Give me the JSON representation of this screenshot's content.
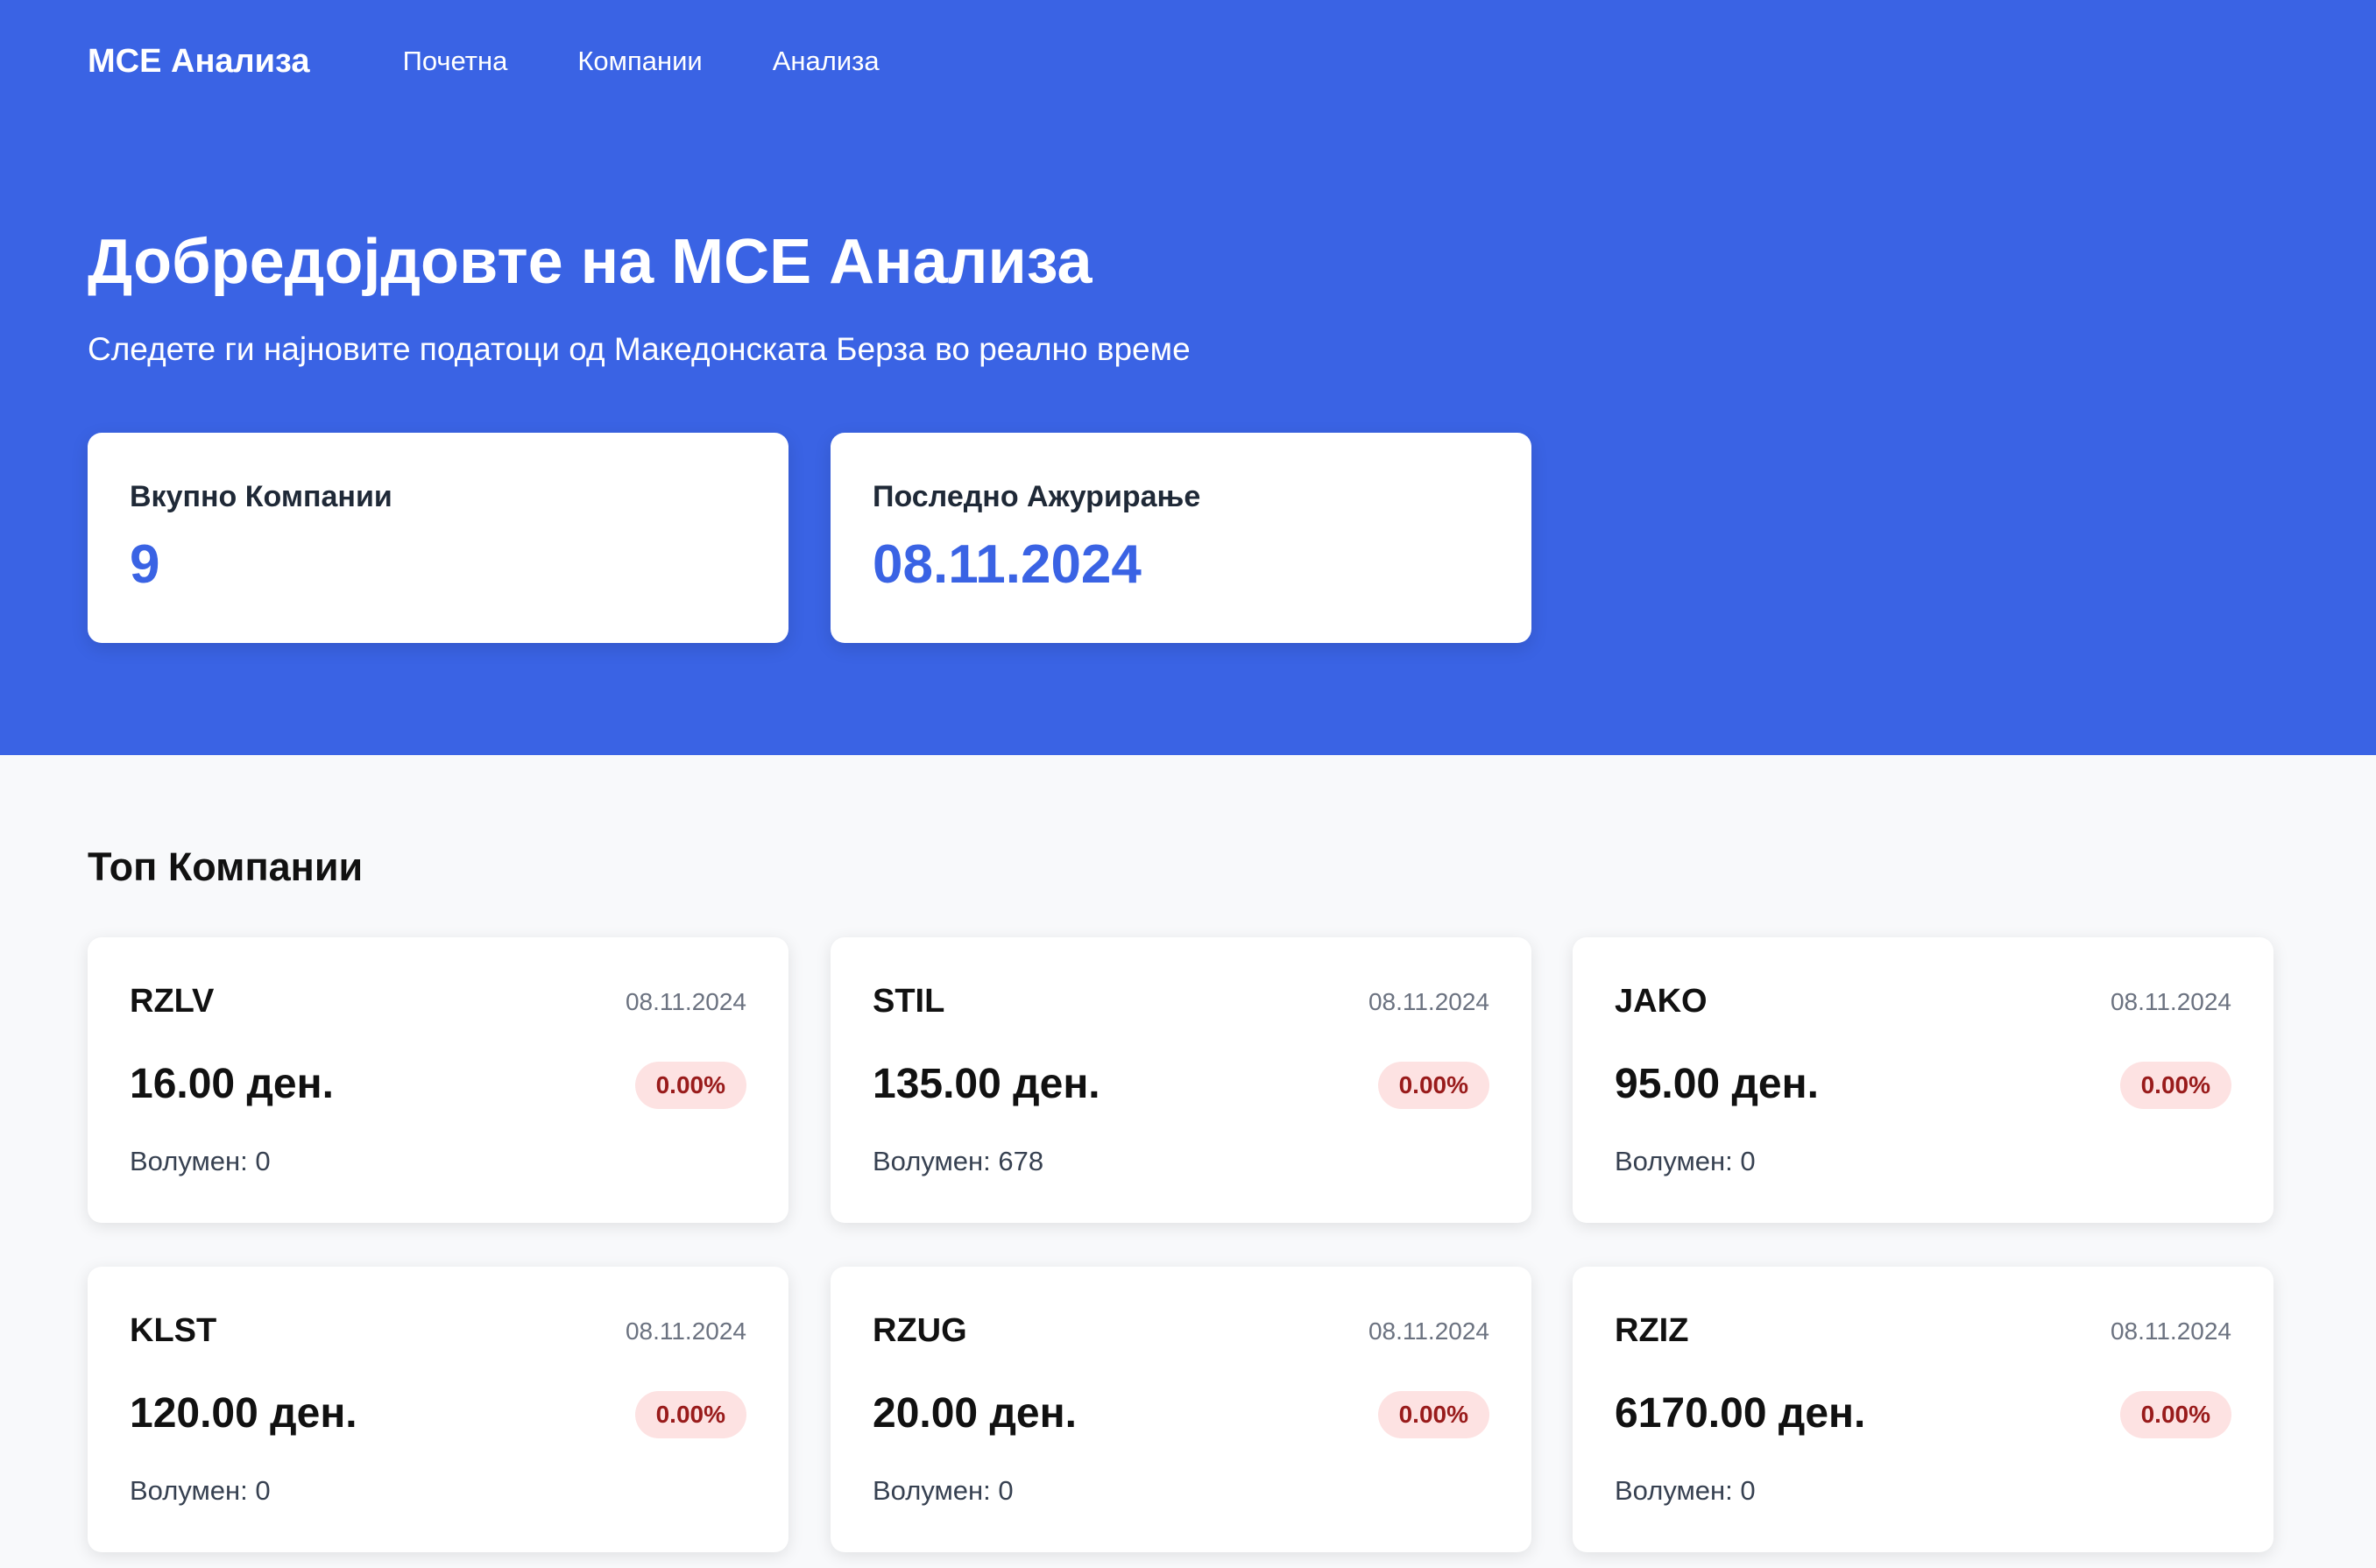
{
  "nav": {
    "brand": "МСЕ Анализа",
    "links": [
      "Почетна",
      "Компании",
      "Анализа"
    ]
  },
  "hero": {
    "title": "Добредојдовте на МСЕ Анализа",
    "subtitle": "Следете ги најновите податоци од Македонската Берза во реално време"
  },
  "stats": [
    {
      "label": "Вкупно Компании",
      "value": "9"
    },
    {
      "label": "Последно Ажурирање",
      "value": "08.11.2024"
    }
  ],
  "top_companies": {
    "title": "Топ Компании",
    "items": [
      {
        "symbol": "RZLV",
        "date": "08.11.2024",
        "price": "16.00 ден.",
        "change": "0.00%",
        "volume": "Волумен: 0"
      },
      {
        "symbol": "STIL",
        "date": "08.11.2024",
        "price": "135.00 ден.",
        "change": "0.00%",
        "volume": "Волумен: 678"
      },
      {
        "symbol": "JAKO",
        "date": "08.11.2024",
        "price": "95.00 ден.",
        "change": "0.00%",
        "volume": "Волумен: 0"
      },
      {
        "symbol": "KLST",
        "date": "08.11.2024",
        "price": "120.00 ден.",
        "change": "0.00%",
        "volume": "Волумен: 0"
      },
      {
        "symbol": "RZUG",
        "date": "08.11.2024",
        "price": "20.00 ден.",
        "change": "0.00%",
        "volume": "Волумен: 0"
      },
      {
        "symbol": "RZIZ",
        "date": "08.11.2024",
        "price": "6170.00 ден.",
        "change": "0.00%",
        "volume": "Волумен: 0"
      }
    ]
  },
  "colors": {
    "primary": "#3a63e4",
    "page_background": "#f8f9fb",
    "negative_badge_bg": "#fde2e2",
    "negative_badge_text": "#991b1b"
  }
}
